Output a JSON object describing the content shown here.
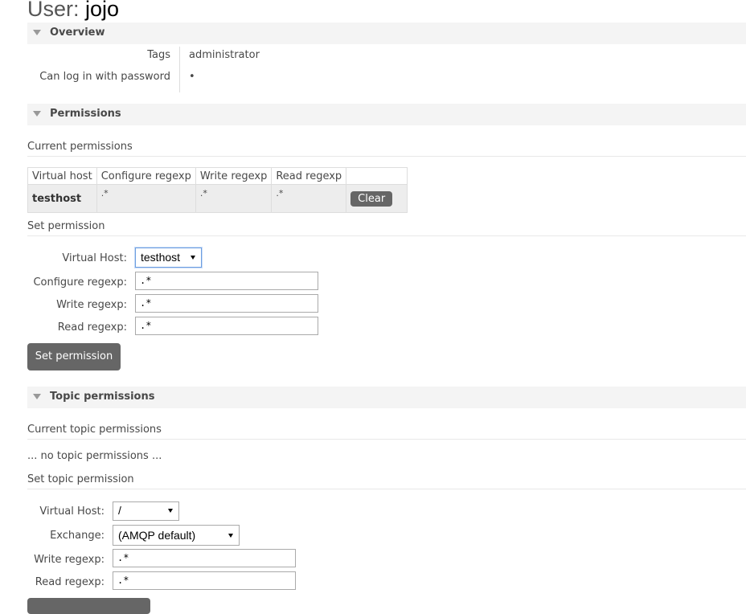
{
  "header": {
    "prefix": "User:",
    "username": "jojo"
  },
  "overview": {
    "title": "Overview",
    "tags_label": "Tags",
    "tags_value": "administrator",
    "login_label": "Can log in with password",
    "login_value": "•"
  },
  "permissions": {
    "title": "Permissions",
    "current_heading": "Current permissions",
    "columns": [
      "Virtual host",
      "Configure regexp",
      "Write regexp",
      "Read regexp"
    ],
    "rows": [
      {
        "vhost": "testhost",
        "configure": ".*",
        "write": ".*",
        "read": ".*",
        "action": "Clear"
      }
    ],
    "set_heading": "Set permission",
    "vhost_label": "Virtual Host:",
    "vhost_value": "testhost",
    "configure_label": "Configure regexp:",
    "configure_value": ".*",
    "write_label": "Write regexp:",
    "write_value": ".*",
    "read_label": "Read regexp:",
    "read_value": ".*",
    "submit_label": "Set permission"
  },
  "topic_permissions": {
    "title": "Topic permissions",
    "current_heading": "Current topic permissions",
    "empty_text": "... no topic permissions ...",
    "set_heading": "Set topic permission",
    "vhost_label": "Virtual Host:",
    "vhost_value": "/",
    "exchange_label": "Exchange:",
    "exchange_value": "(AMQP default)",
    "write_label": "Write regexp:",
    "write_value": ".*",
    "read_label": "Read regexp:",
    "read_value": ".*"
  }
}
